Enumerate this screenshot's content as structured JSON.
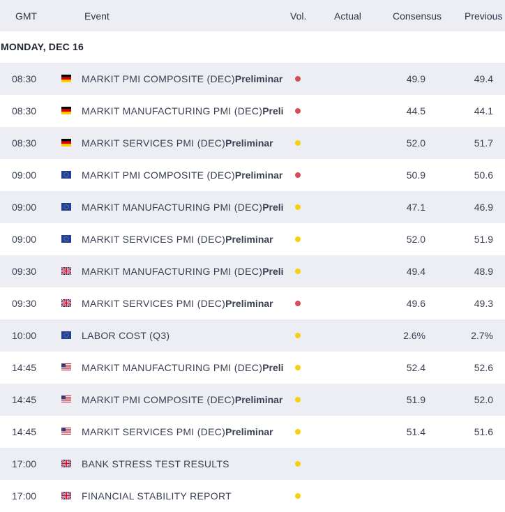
{
  "header": {
    "gmt": "GMT",
    "event": "Event",
    "vol": "Vol.",
    "actual": "Actual",
    "consensus": "Consensus",
    "previous": "Previous"
  },
  "day_label": "MONDAY, DEC 16",
  "colors": {
    "high": "#d64c57",
    "medium": "#f6d20d",
    "stripe": "#eceef3"
  },
  "rows": [
    {
      "time": "08:30",
      "flag": "germany-flag-icon",
      "event": "MARKIT PMI COMPOSITE (DEC)",
      "event_suffix": "Preliminar",
      "volatility": "high",
      "actual": "",
      "consensus": "49.9",
      "previous": "49.4"
    },
    {
      "time": "08:30",
      "flag": "germany-flag-icon",
      "event": "MARKIT MANUFACTURING PMI (DEC)",
      "event_suffix": "Preliminar",
      "volatility": "high",
      "actual": "",
      "consensus": "44.5",
      "previous": "44.1"
    },
    {
      "time": "08:30",
      "flag": "germany-flag-icon",
      "event": "MARKIT SERVICES PMI (DEC)",
      "event_suffix": "Preliminar",
      "volatility": "medium",
      "actual": "",
      "consensus": "52.0",
      "previous": "51.7"
    },
    {
      "time": "09:00",
      "flag": "eu-flag-icon",
      "event": "MARKIT PMI COMPOSITE (DEC)",
      "event_suffix": "Preliminar",
      "volatility": "high",
      "actual": "",
      "consensus": "50.9",
      "previous": "50.6"
    },
    {
      "time": "09:00",
      "flag": "eu-flag-icon",
      "event": "MARKIT MANUFACTURING PMI (DEC)",
      "event_suffix": "Preliminar",
      "volatility": "medium",
      "actual": "",
      "consensus": "47.1",
      "previous": "46.9"
    },
    {
      "time": "09:00",
      "flag": "eu-flag-icon",
      "event": "MARKIT SERVICES PMI (DEC)",
      "event_suffix": "Preliminar",
      "volatility": "medium",
      "actual": "",
      "consensus": "52.0",
      "previous": "51.9"
    },
    {
      "time": "09:30",
      "flag": "uk-flag-icon",
      "event": "MARKIT MANUFACTURING PMI (DEC)",
      "event_suffix": "Preliminar",
      "volatility": "medium",
      "actual": "",
      "consensus": "49.4",
      "previous": "48.9"
    },
    {
      "time": "09:30",
      "flag": "uk-flag-icon",
      "event": "MARKIT SERVICES PMI (DEC)",
      "event_suffix": "Preliminar",
      "volatility": "high",
      "actual": "",
      "consensus": "49.6",
      "previous": "49.3"
    },
    {
      "time": "10:00",
      "flag": "eu-flag-icon",
      "event": "LABOR COST (Q3)",
      "event_suffix": "",
      "volatility": "medium",
      "actual": "",
      "consensus": "2.6%",
      "previous": "2.7%"
    },
    {
      "time": "14:45",
      "flag": "us-flag-icon",
      "event": "MARKIT MANUFACTURING PMI (DEC)",
      "event_suffix": "Preliminar",
      "volatility": "medium",
      "actual": "",
      "consensus": "52.4",
      "previous": "52.6"
    },
    {
      "time": "14:45",
      "flag": "us-flag-icon",
      "event": "MARKIT PMI COMPOSITE (DEC)",
      "event_suffix": "Preliminar",
      "volatility": "medium",
      "actual": "",
      "consensus": "51.9",
      "previous": "52.0"
    },
    {
      "time": "14:45",
      "flag": "us-flag-icon",
      "event": "MARKIT SERVICES PMI (DEC)",
      "event_suffix": "Preliminar",
      "volatility": "medium",
      "actual": "",
      "consensus": "51.4",
      "previous": "51.6"
    },
    {
      "time": "17:00",
      "flag": "uk-flag-icon",
      "event": "BANK STRESS TEST RESULTS",
      "event_suffix": "",
      "volatility": "medium",
      "actual": "",
      "consensus": "",
      "previous": ""
    },
    {
      "time": "17:00",
      "flag": "uk-flag-icon",
      "event": "FINANCIAL STABILITY REPORT",
      "event_suffix": "",
      "volatility": "medium",
      "actual": "",
      "consensus": "",
      "previous": ""
    }
  ]
}
